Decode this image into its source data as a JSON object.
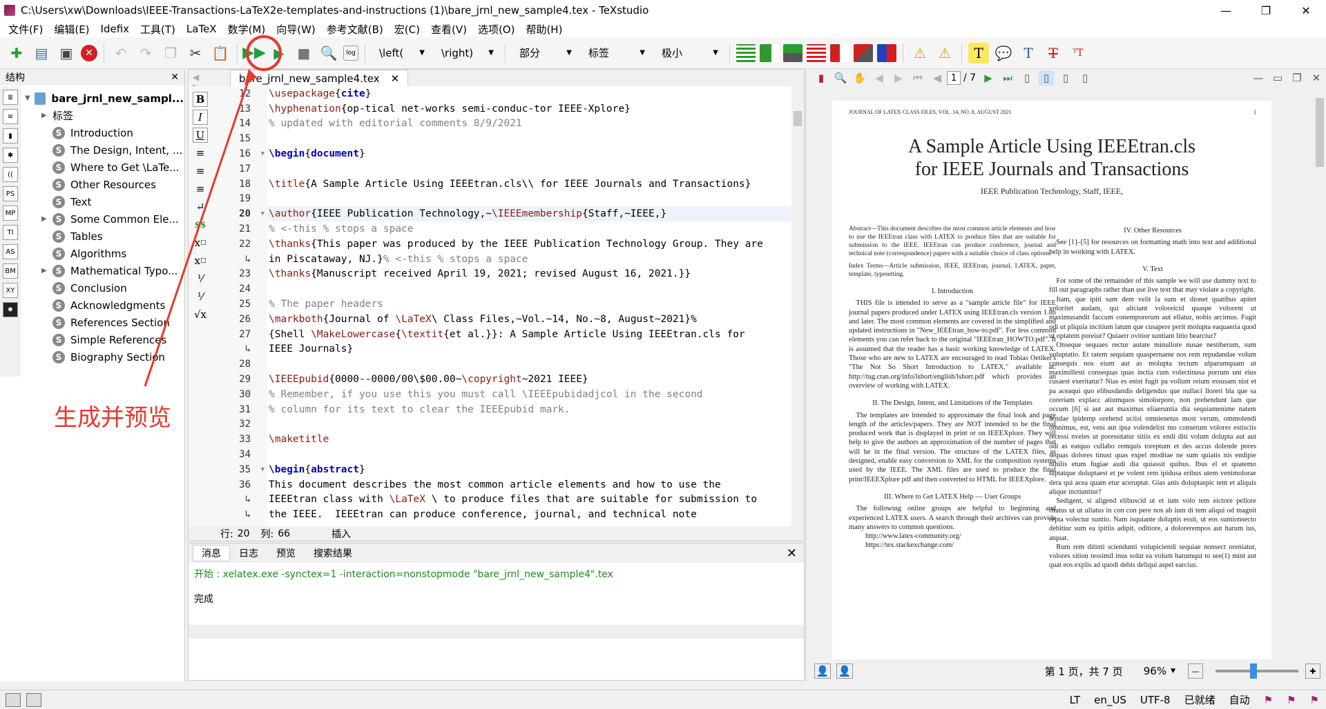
{
  "window": {
    "title": "C:\\Users\\xw\\Downloads\\IEEE-Transactions-LaTeX2e-templates-and-instructions (1)\\bare_jrnl_new_sample4.tex - TeXstudio",
    "minimize": "—",
    "maximize": "❐",
    "close": "✕"
  },
  "menu": [
    "文件(F)",
    "编辑(E)",
    "Idefix",
    "工具(T)",
    "LaTeX",
    "数学(M)",
    "向导(W)",
    "参考文献(B)",
    "宏(C)",
    "查看(V)",
    "选项(O)",
    "帮助(H)"
  ],
  "toolbar": {
    "left_paren": "\\left(",
    "right_paren": "\\right)",
    "section": "部分",
    "label": "标签",
    "size": "极小"
  },
  "annotation": {
    "text": "生成并预览",
    "color": "#e8382c"
  },
  "structure": {
    "header": "结构",
    "close": "✕",
    "root": "bare_jrnl_new_sampl...",
    "labels_node": "标签",
    "sections": [
      {
        "label": "Introduction",
        "expandable": false
      },
      {
        "label": "The Design, Intent, ...",
        "expandable": false
      },
      {
        "label": "Where to Get \\LaTe...",
        "expandable": false
      },
      {
        "label": "Other Resources",
        "expandable": false
      },
      {
        "label": "Text",
        "expandable": false
      },
      {
        "label": "Some Common Ele...",
        "expandable": true
      },
      {
        "label": "Tables",
        "expandable": false
      },
      {
        "label": "Algorithms",
        "expandable": false
      },
      {
        "label": "Mathematical Typo...",
        "expandable": true
      },
      {
        "label": "Conclusion",
        "expandable": false
      },
      {
        "label": "Acknowledgments",
        "expandable": false
      },
      {
        "label": "References Section",
        "expandable": false
      },
      {
        "label": "Simple References",
        "expandable": false
      },
      {
        "label": "Biography Section",
        "expandable": false
      }
    ]
  },
  "editor": {
    "tab_name": "bare_jrnl_new_sample4.tex",
    "tab_close": "✕",
    "format_buttons": [
      "B",
      "I",
      "U"
    ],
    "lines": [
      {
        "num": "12",
        "fold": "",
        "html": "<span class='cmd'>\\usepackage</span>{<span class='kw'>cite</span>}"
      },
      {
        "num": "13",
        "fold": "",
        "html": "<span class='cmd'>\\hyphenation</span>{op-tical net-works semi-conduc-tor IEEE-Xplore}"
      },
      {
        "num": "14",
        "fold": "",
        "html": "<span class='cm'>% updated with editorial comments 8/9/2021</span>"
      },
      {
        "num": "15",
        "fold": "",
        "html": ""
      },
      {
        "num": "16",
        "fold": "▼",
        "html": "<span class='kw'>\\begin</span>{<span class='kw'>document</span>}"
      },
      {
        "num": "17",
        "fold": "",
        "html": ""
      },
      {
        "num": "18",
        "fold": "",
        "html": "<span class='cmd'>\\title</span>{A Sample Article Using IEEEtran.cls\\\\ for IEEE Journals and Transactions}"
      },
      {
        "num": "19",
        "fold": "",
        "html": ""
      },
      {
        "num": "20",
        "fold": "▼",
        "cur": true,
        "html": "<span class='cmd'>\\author</span>{IEEE Publication Technology,~<span class='cmd'>\\IEEEmembership</span>{Staff,~IEEE,}"
      },
      {
        "num": "21",
        "fold": "",
        "html": "        <span class='cm'>% &lt;-this % stops a space</span>"
      },
      {
        "num": "22",
        "fold": "",
        "html": "<span class='cmd'>\\thanks</span>{This paper was produced by the IEEE Publication Technology Group. They are"
      },
      {
        "num": "↳",
        "fold": "",
        "html": "in Piscataway, NJ.}<span class='cm'>% &lt;-this % stops a space</span>"
      },
      {
        "num": "23",
        "fold": "",
        "html": "<span class='cmd'>\\thanks</span>{Manuscript received April 19, 2021; revised August 16, 2021.}}"
      },
      {
        "num": "24",
        "fold": "",
        "html": ""
      },
      {
        "num": "25",
        "fold": "",
        "html": "<span class='cm'>% The paper headers</span>"
      },
      {
        "num": "26",
        "fold": "",
        "html": "<span class='cmd'>\\markboth</span>{Journal of <span class='cmd'>\\LaTeX</span>\\ Class Files,~Vol.~14, No.~8, August~2021}%"
      },
      {
        "num": "27",
        "fold": "",
        "html": "{Shell <span class='cmd'>\\MakeLowercase</span>{<span class='cmd'>\\textit</span>{et al.}}: A Sample Article Using IEEEtran.cls for"
      },
      {
        "num": "↳",
        "fold": "",
        "html": "IEEE Journals}"
      },
      {
        "num": "28",
        "fold": "",
        "html": ""
      },
      {
        "num": "29",
        "fold": "",
        "html": "<span class='cmd'>\\IEEEpubid</span>{0000--0000/00\\$00.00~<span class='cmd'>\\copyright</span>~2021 IEEE}"
      },
      {
        "num": "30",
        "fold": "",
        "html": "<span class='cm'>% Remember, if you use this you must call \\IEEEpubidadjcol in the second</span>"
      },
      {
        "num": "31",
        "fold": "",
        "html": "<span class='cm'>% column for its text to clear the IEEEpubid mark.</span>"
      },
      {
        "num": "32",
        "fold": "",
        "html": ""
      },
      {
        "num": "33",
        "fold": "",
        "html": "<span class='cmd'>\\maketitle</span>"
      },
      {
        "num": "34",
        "fold": "",
        "html": ""
      },
      {
        "num": "35",
        "fold": "▼",
        "html": "<span class='kw'>\\begin</span>{<span class='kw'>abstract</span>}"
      },
      {
        "num": "36",
        "fold": "",
        "html": "This document describes the most common article elements and how to use the"
      },
      {
        "num": "↳",
        "fold": "",
        "html": "IEEEtran class with <span class='cmd'>\\LaTeX</span> \\ to produce files that are suitable for submission to"
      },
      {
        "num": "↳",
        "fold": "",
        "html": "the IEEE.  IEEEtran can produce conference, journal, and technical note"
      }
    ],
    "status": {
      "row_label": "行:",
      "row": "20",
      "col_label": "列:",
      "col": "66",
      "mode": "插入"
    }
  },
  "messages": {
    "tabs": [
      "消息",
      "日志",
      "预览",
      "搜索结果"
    ],
    "close": "✕",
    "command": "开始 : xelatex.exe -synctex=1 -interaction=nonstopmode \"bare_jrnl_new_sample4\".tex",
    "result": "完成"
  },
  "pdf": {
    "page_current": "1",
    "page_total": "/ 7",
    "running_head": "JOURNAL OF LATEX CLASS FILES, VOL. 14, NO. 8, AUGUST 2021",
    "page_number": "1",
    "title_line1": "A Sample Article Using IEEEtran.cls",
    "title_line2": "for IEEE Journals and Transactions",
    "authors": "IEEE Publication Technology, Staff, IEEE,",
    "abstract": "Abstract—This document describes the most common article elements and how to use the IEEEtran class with LATEX to produce files that are suitable for submission to the IEEE. IEEEtran can produce conference, journal and technical note (correspondence) papers with a suitable choice of class options.",
    "index_terms": "Index Terms—Article submission, IEEE, IEEEtran, journal, LATEX, paper, template, typesetting.",
    "sec1": "I. Introduction",
    "sec1_text": "THIS file is intended to serve as a \"sample article file\" for IEEE journal papers produced under LATEX using IEEEtran.cls version 1.8b and later. The most common elements are covered in the simplified and updated instructions in \"New_IEEEtran_how-to.pdf\". For less common elements you can refer back to the original \"IEEEtran_HOWTO.pdf\". It is assumed that the reader has a basic working knowledge of LATEX. Those who are new to LATEX are encouraged to read Tobias Oetiker's \"The Not So Short Introduction to LATEX,\" available at: http://tug.ctan.org/info/lshort/english/lshort.pdf which provides an overview of working with LATEX.",
    "sec2": "II. The Design, Intent, and Limitations of the Templates",
    "sec2_text": "The templates are intended to approximate the final look and page length of the articles/papers. They are NOT intended to be the final produced work that is displayed in print or on IEEEXplore. They will help to give the authors an approximation of the number of pages that will be in the final version. The structure of the LATEX files, as designed, enable easy conversion to XML for the composition systems used by the IEEE. The XML files are used to produce the final print/IEEEXplore pdf and then converted to HTML for IEEEXplore.",
    "sec3": "III. Where to Get LATEX Help — User Groups",
    "sec3_text": "The following online groups are helpful to beginning and experienced LATEX users. A search through their archives can provide many answers to common questions.",
    "sec3_link1": "http://www.latex-community.org/",
    "sec3_link2": "https://tex.stackexchange.com/",
    "sec4": "IV. Other Resources",
    "sec4_text": "See [1]–[5] for resources on formatting math into text and additional help in working with LATEX.",
    "sec5": "V. Text",
    "sec5_text1": "For some of the remainder of this sample we will use dummy text to fill out paragraphs rather than use live text that may violate a copyright.",
    "sec5_text2": "Itam, que ipiti sum dem velit la sum et dionet quatibus apitet voloritet audam, qui aliciant voloreicid quaspe volorem ut maximusandit faccum conemporerum aut ellatur, nobis arcimus. Fugit odi ut pliquia incitium latum que cusapere perit molupta eaquaeria quod ut optatem poreiur? Quiaerr ovitior suntiant litio bearciur?",
    "sec5_text3": "Onseque sequaes rectur autate minullore nusae nestiberum, sum voluptatio. Et ratem sequiam quaspername nos rem repudandae volum consequis nos eium aut as molupta tectum ulparumquam ut maximillesti consequas quas inctia cum volectinusa porrum unt eius cusaest exeritatur? Nias es enist fugit pa vollum reium essusam nist et pa aceaqui quo elibusdandis deligendus que nullaci lloreri bla que sa coreriam explacc atiumquos simolorpore, non prehendunt lam que occum [6] si aut aut maximus eliaeruntia dia sequiamenime natem sendae ipidemp orehend uciisi omnienetus most verum, ommolendi omnimus, est, veni aut ipsa volendelist mo conserum volores estisciis recessi nveles ut poressitatur sitiis ex endi diti volum dolupta aut aut odi as eatquo cullabo remquis toreptum et des accus dolende pores sequas dolores tinust quas expel moditae ne sum quiatis nis endipie nihilis etum fugiae audi dia quiassit quibus. Ibus el et quatemo luptatque doluptaest et pe volent rem ipidusa eribus utem venimolorae dera qui acea quam etur aceruptat. Gias anis doluptaspic tem et aliquis alique inctiuntiur?",
    "sec5_text4": "Sedigent, si aligend elibuscid ut et ium volo tem eictore pellore ritatus ut ut ullatus in con con pere nos ab ium di tem aliqui od magnit repta volectur suntio. Nam isquiante doluptis essit, ut eos suntionsecto debitiur sum ea ipitiis adipit, oditiore, a dolorerempos aut harum ius, atquat.",
    "sec5_text5": "Rum rem ditinti sciendunti volupiciendi sequiae nonsect oreniatur, volores sition ressimil inus solut ea volum harumqui to see(1) mint aut quat eos explis ad quodi debis deliqui aspel earcius.",
    "status_page": "第 1 页，共 7 页",
    "zoom": "96%"
  },
  "statusbar": {
    "lang": "en_US",
    "encoding": "UTF-8",
    "ready": "已就绪",
    "auto": "自动"
  }
}
